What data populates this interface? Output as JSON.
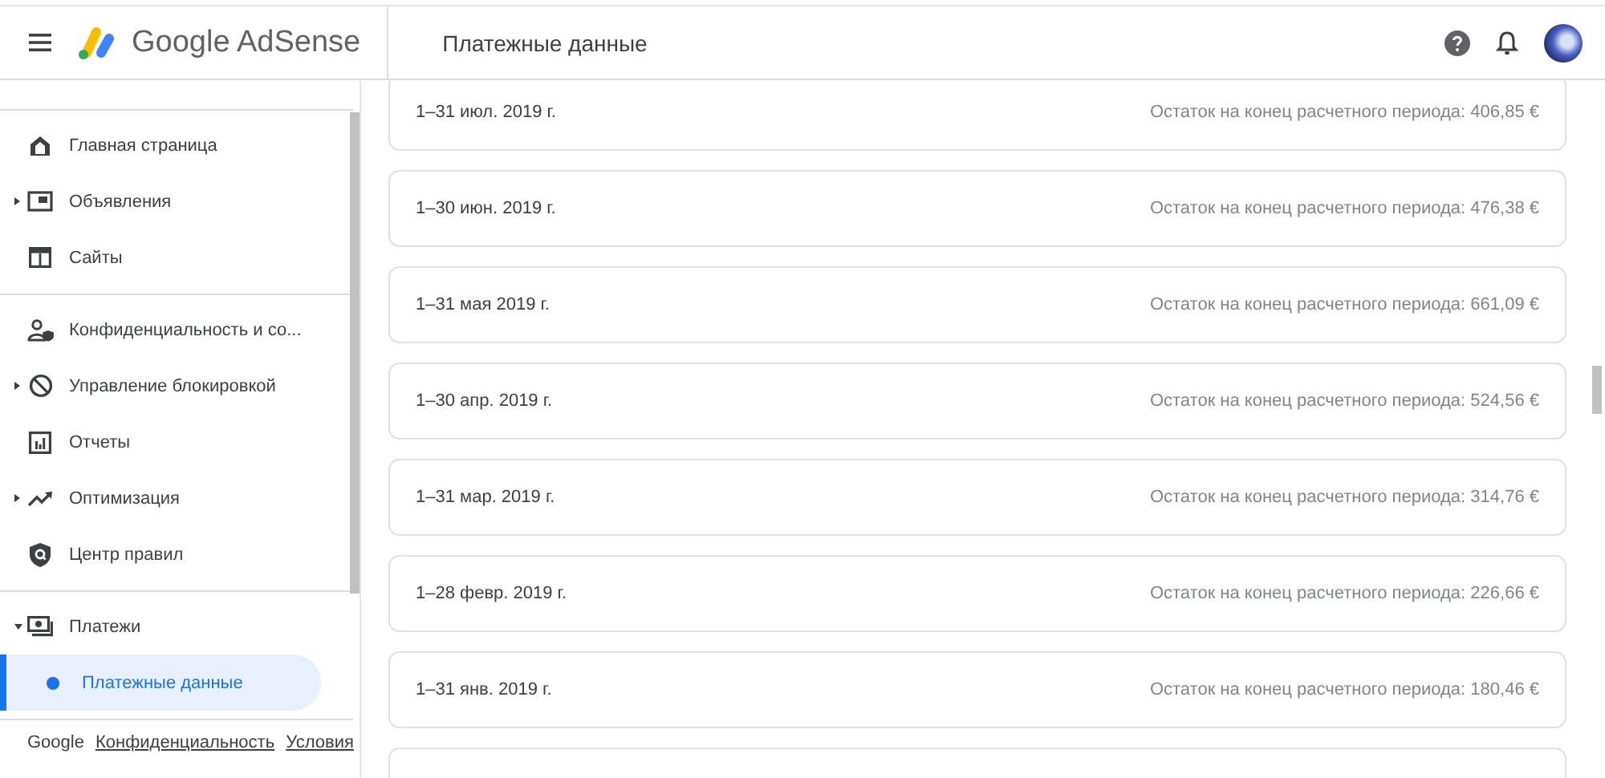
{
  "header": {
    "product": "Google AdSense",
    "page_title": "Платежные данные"
  },
  "sidebar": {
    "groups": [
      {
        "items": [
          {
            "label": "Главная страница"
          },
          {
            "label": "Объявления",
            "expanded": false
          },
          {
            "label": "Сайты"
          }
        ]
      },
      {
        "items": [
          {
            "label": "Конфиденциальность и со..."
          },
          {
            "label": "Управление блокировкой",
            "expanded": false
          },
          {
            "label": "Отчеты"
          },
          {
            "label": "Оптимизация",
            "expanded": false
          },
          {
            "label": "Центр правил"
          }
        ]
      },
      {
        "items": [
          {
            "label": "Платежи",
            "expanded": true,
            "children": [
              {
                "label": "Платежные данные",
                "selected": true
              }
            ]
          }
        ]
      }
    ],
    "footer": [
      "Google",
      "Конфиденциальность",
      "Условия"
    ]
  },
  "statements": [
    {
      "period": "1–31 июл. 2019 г.",
      "balance": "Остаток на конец расчетного периода: 406,85 €"
    },
    {
      "period": "1–30 июн. 2019 г.",
      "balance": "Остаток на конец расчетного периода: 476,38 €"
    },
    {
      "period": "1–31 мая 2019 г.",
      "balance": "Остаток на конец расчетного периода: 661,09 €"
    },
    {
      "period": "1–30 апр. 2019 г.",
      "balance": "Остаток на конец расчетного периода: 524,56 €"
    },
    {
      "period": "1–31 мар. 2019 г.",
      "balance": "Остаток на конец расчетного периода: 314,76 €"
    },
    {
      "period": "1–28 февр. 2019 г.",
      "balance": "Остаток на конец расчетного периода: 226,66 €"
    },
    {
      "period": "1–31 янв. 2019 г.",
      "balance": "Остаток на конец расчетного периода: 180,46 €"
    }
  ]
}
